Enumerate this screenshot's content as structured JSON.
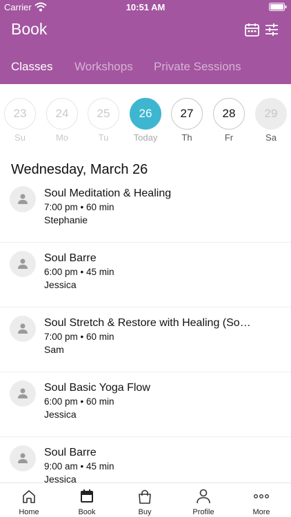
{
  "status_bar": {
    "carrier": "Carrier",
    "time": "10:51 AM"
  },
  "header": {
    "title": "Book"
  },
  "tabs": [
    {
      "label": "Classes",
      "active": true
    },
    {
      "label": "Workshops",
      "active": false
    },
    {
      "label": "Private Sessions",
      "active": false
    }
  ],
  "week": [
    {
      "day": "23",
      "label": "Su",
      "state": "past"
    },
    {
      "day": "24",
      "label": "Mo",
      "state": "past"
    },
    {
      "day": "25",
      "label": "Tu",
      "state": "past"
    },
    {
      "day": "26",
      "label": "Today",
      "state": "selected"
    },
    {
      "day": "27",
      "label": "Th",
      "state": "future"
    },
    {
      "day": "28",
      "label": "Fr",
      "state": "future"
    },
    {
      "day": "29",
      "label": "Sa",
      "state": "disabled"
    }
  ],
  "date_heading": "Wednesday, March 26",
  "classes": [
    {
      "name": "Soul Meditation & Healing",
      "time": "7:00 pm • 60 min",
      "teacher": "Stephanie"
    },
    {
      "name": "Soul Barre",
      "time": "6:00 pm • 45 min",
      "teacher": "Jessica"
    },
    {
      "name": "Soul Stretch & Restore with Healing (So…",
      "time": "7:00 pm • 60 min",
      "teacher": "Sam"
    },
    {
      "name": "Soul Basic Yoga Flow",
      "time": "6:00 pm • 60 min",
      "teacher": "Jessica"
    },
    {
      "name": "Soul Barre",
      "time": "9:00 am • 45 min",
      "teacher": "Jessica"
    }
  ],
  "bottom_nav": [
    {
      "label": "Home",
      "icon": "home-icon"
    },
    {
      "label": "Book",
      "icon": "calendar-icon",
      "active": true
    },
    {
      "label": "Buy",
      "icon": "shopping-bag-icon"
    },
    {
      "label": "Profile",
      "icon": "profile-icon"
    },
    {
      "label": "More",
      "icon": "more-icon"
    }
  ],
  "colors": {
    "brand": "#a3559f",
    "selected_day": "#3fb6d0"
  }
}
